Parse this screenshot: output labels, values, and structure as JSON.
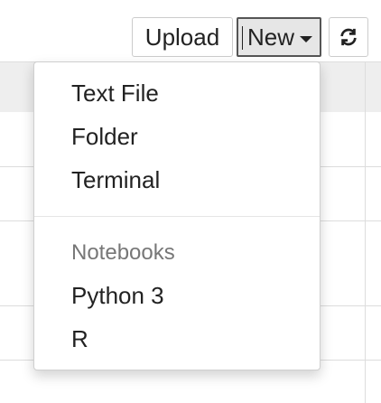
{
  "toolbar": {
    "upload_label": "Upload",
    "new_label": "New",
    "refresh_icon": "refresh-icon"
  },
  "new_menu": {
    "items": [
      {
        "label": "Text File"
      },
      {
        "label": "Folder"
      },
      {
        "label": "Terminal"
      }
    ],
    "notebooks_header": "Notebooks",
    "notebooks": [
      {
        "label": "Python 3"
      },
      {
        "label": "R"
      }
    ]
  },
  "colors": {
    "header_bg": "#eeeeee",
    "menu_header_text": "#777777",
    "active_button_bg": "#e6e6e6"
  }
}
